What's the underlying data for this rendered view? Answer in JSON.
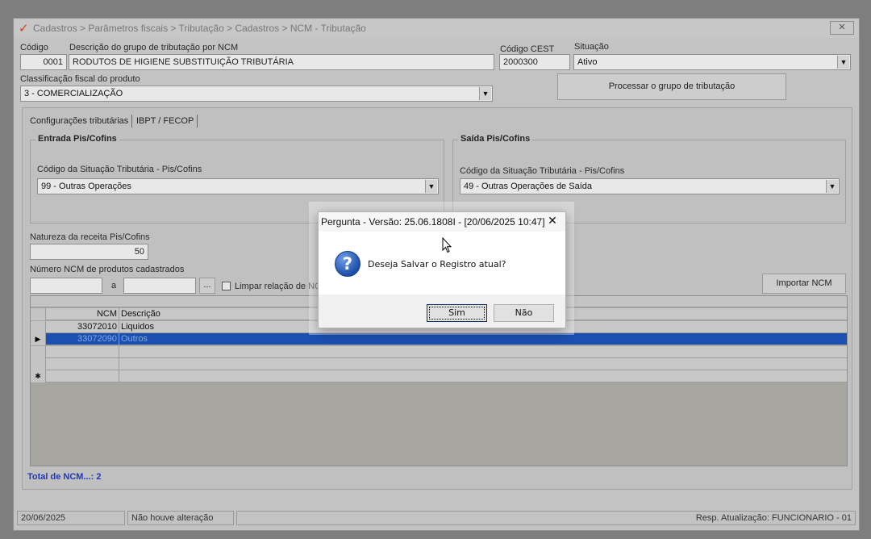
{
  "window": {
    "title": "Cadastros > Parâmetros fiscais > Tributação > Cadastros > NCM - Tributação",
    "logo": "✓",
    "close_glyph": "✕"
  },
  "form": {
    "codigo_label": "Código",
    "codigo_value": "0001",
    "descricao_label": "Descrição do grupo de tributação por NCM",
    "descricao_value": "RODUTOS DE HIGIENE SUBSTITUIÇÃO TRIBUTÁRIA",
    "cest_label": "Código CEST",
    "cest_value": "2000300",
    "situacao_label": "Situação",
    "situacao_value": "Ativo",
    "classificacao_label": "Classificação fiscal do produto",
    "classificacao_value": "3 - COMERCIALIZAÇÃO",
    "processar_label": "Processar o grupo de tributação"
  },
  "tabs": [
    {
      "label": "Configurações tributárias"
    },
    {
      "label": "IBPT / FECOP"
    }
  ],
  "entrada": {
    "title": "Entrada Pis/Cofins",
    "cst_label": "Código da Situação Tributária - Pis/Cofins",
    "cst_value": "99 - Outras Operações"
  },
  "saida": {
    "title": "Saída Pis/Cofins",
    "cst_label": "Código da Situação Tributária - Pis/Cofins",
    "cst_value": "49 - Outras Operações de Saída"
  },
  "natureza": {
    "label": "Natureza da receita Pis/Cofins",
    "value": "50"
  },
  "ncm_range": {
    "label": "Número  NCM de produtos cadastrados",
    "to_label": "a",
    "browse_label": "...",
    "limpar_label": "Limpar relação de NC",
    "importar_label": "Importar NCM"
  },
  "grid": {
    "columns": [
      "NCM",
      "Descrição"
    ],
    "rows": [
      {
        "ncm": "33072010",
        "desc": "Liquidos",
        "indicator": ""
      },
      {
        "ncm": "33072090",
        "desc": "Outros",
        "indicator": "▶"
      }
    ],
    "new_row_indicator": "✱"
  },
  "total_label": "Total de NCM...: 2",
  "status": {
    "date": "20/06/2025",
    "change": "Não houve alteração",
    "resp": "Resp. Atualização: FUNCIONARIO - 01"
  },
  "dialog": {
    "title": "Pergunta - Versão: 25.06.1808I - [20/06/2025 10:47]",
    "close_glyph": "✕",
    "icon_glyph": "?",
    "message": "Deseja Salvar o Registro atual?",
    "yes_label": "Sim",
    "no_label": "Não"
  }
}
